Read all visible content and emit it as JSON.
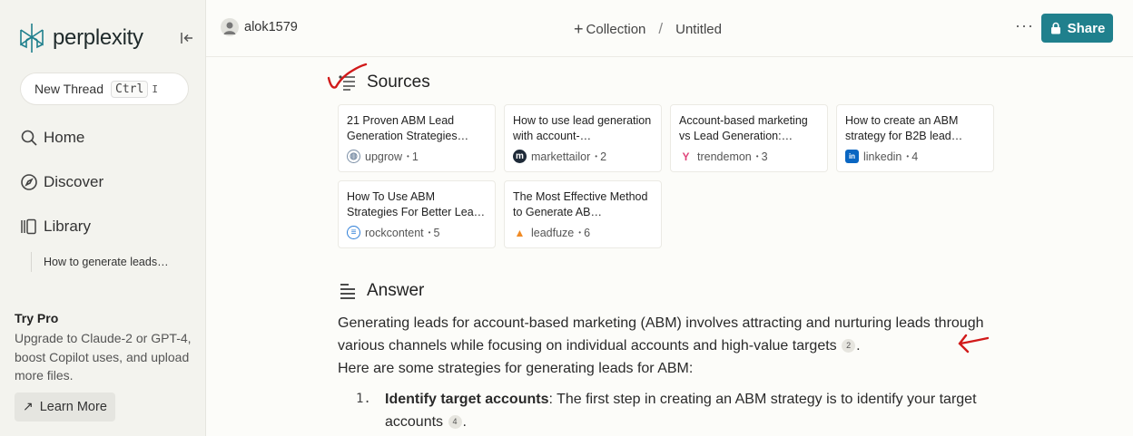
{
  "brand": {
    "name": "perplexity"
  },
  "sidebar": {
    "new_thread_label": "New Thread",
    "new_thread_kbd": "Ctrl",
    "new_thread_kbd2": "I",
    "nav": [
      {
        "label": "Home",
        "icon": "search-icon"
      },
      {
        "label": "Discover",
        "icon": "compass-icon"
      },
      {
        "label": "Library",
        "icon": "library-icon"
      }
    ],
    "library_items": [
      "How to generate leads…"
    ],
    "try_pro": {
      "title": "Try Pro",
      "description": "Upgrade to Claude-2 or GPT-4, boost Copilot uses, and upload more files.",
      "button_label": "Learn More"
    }
  },
  "topbar": {
    "username": "alok1579",
    "collection_label": "Collection",
    "separator": "/",
    "thread_title": "Untitled",
    "more_label": "···",
    "share_label": "Share"
  },
  "sources": {
    "heading": "Sources",
    "cards": [
      {
        "title": "21 Proven ABM Lead Generation Strategies…",
        "site": "upgrow",
        "index": "1",
        "favicon": "globe-icon",
        "color": "#7b8fa6"
      },
      {
        "title": "How to use lead generation with account-…",
        "site": "markettailor",
        "index": "2",
        "favicon": "markettailor-icon",
        "color": "#1e2a38"
      },
      {
        "title": "Account-based marketing vs Lead Generation:…",
        "site": "trendemon",
        "index": "3",
        "favicon": "trendemon-icon",
        "color": "#e0457b"
      },
      {
        "title": "How to create an ABM strategy for B2B lead…",
        "site": "linkedin",
        "index": "4",
        "favicon": "linkedin-icon",
        "color": "#0a66c2"
      },
      {
        "title": "How To Use ABM Strategies For Better Lea…",
        "site": "rockcontent",
        "index": "5",
        "favicon": "rockcontent-icon",
        "color": "#2f7fd8"
      },
      {
        "title": "The Most Effective Method to Generate AB…",
        "site": "leadfuze",
        "index": "6",
        "favicon": "flame-icon",
        "color": "#f08a24"
      }
    ]
  },
  "answer": {
    "heading": "Answer",
    "paragraph_1": "Generating leads for account-based marketing (ABM) involves attracting and nurturing leads through various channels while focusing on individual accounts and high-value targets",
    "cite_1": "2",
    "paragraph_1_end": ".",
    "paragraph_2": "Here are some strategies for generating leads for ABM:",
    "list": [
      {
        "number": "1.",
        "bold": "Identify target accounts",
        "text": ": The first step in creating an ABM strategy is to identify your target accounts",
        "cite": "4",
        "end": "."
      }
    ]
  },
  "colors": {
    "accent": "#20808d",
    "annotation": "#d11a1a"
  }
}
